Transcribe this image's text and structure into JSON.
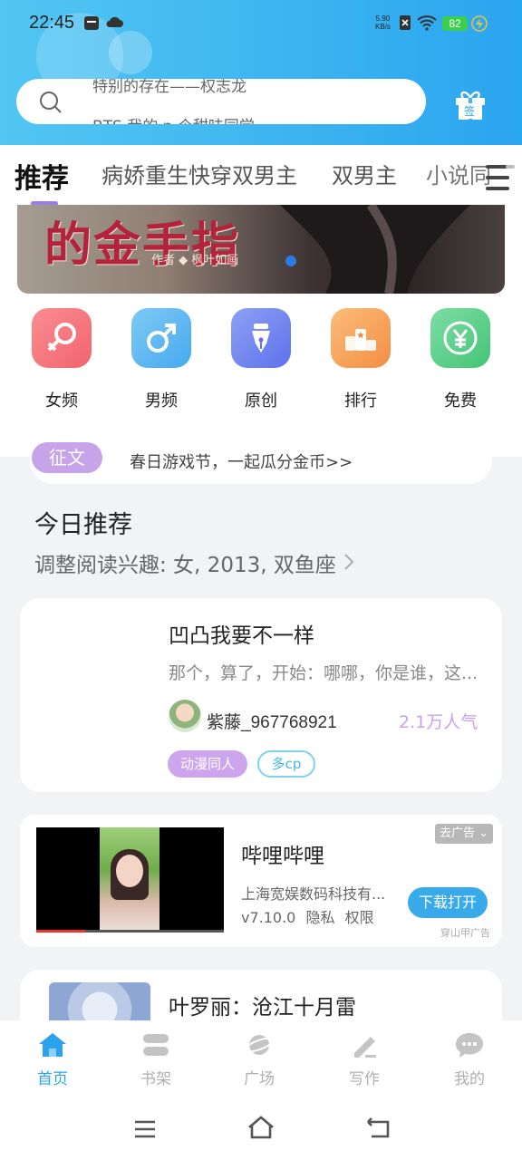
{
  "status_bar": {
    "time": "22:45",
    "net_speed_value": "5.90",
    "net_speed_unit": "KB/s",
    "battery": "82"
  },
  "search": {
    "hint_top": "特别的存在——权志龙",
    "hint_bottom": "BTS 我的 n 个甜味同学"
  },
  "gift_button_label": "签",
  "tabs": [
    {
      "label": "推荐"
    },
    {
      "label": "病娇重生快穿双男主"
    },
    {
      "label": "双男主"
    },
    {
      "label": "小说同"
    }
  ],
  "banner": {
    "title": "的金手指",
    "subtitle": "作者 ◆ 枫叶如画"
  },
  "categories": [
    {
      "label": "女频",
      "icon": "female-icon",
      "color": "#f4747c"
    },
    {
      "label": "男频",
      "icon": "male-icon",
      "color": "#5bb8f2"
    },
    {
      "label": "原创",
      "icon": "pen-nib-icon",
      "color": "#6f86ee"
    },
    {
      "label": "排行",
      "icon": "podium-icon",
      "color": "#f7a45c"
    },
    {
      "label": "免费",
      "icon": "yen-coin-icon",
      "color": "#58cf86"
    }
  ],
  "notice": {
    "badge": "征文",
    "text": "春日游戏节，一起瓜分金币>>"
  },
  "today": {
    "title": "今日推荐",
    "subtitle": "调整阅读兴趣: 女, 2013, 双鱼座"
  },
  "book1": {
    "title": "凹凸我要不一样",
    "desc": "那个，算了，开始：哪哪，你是谁，这...",
    "author": "紫藤_967768921",
    "popularity": "2.1万人气",
    "tags": [
      "动漫同人",
      "多cp"
    ]
  },
  "ad": {
    "name": "哔哩哔哩",
    "company": "上海宽娱数码科技有...",
    "version": "v7.10.0",
    "privacy": "隐私",
    "permission": "权限",
    "button": "下载打开",
    "close": "去广告",
    "source": "穿山甲广告"
  },
  "book2": {
    "title": "叶罗丽：沧江十月雷"
  },
  "bottom_nav": [
    {
      "label": "首页",
      "active": true
    },
    {
      "label": "书架"
    },
    {
      "label": "广场"
    },
    {
      "label": "写作"
    },
    {
      "label": "我的"
    }
  ]
}
